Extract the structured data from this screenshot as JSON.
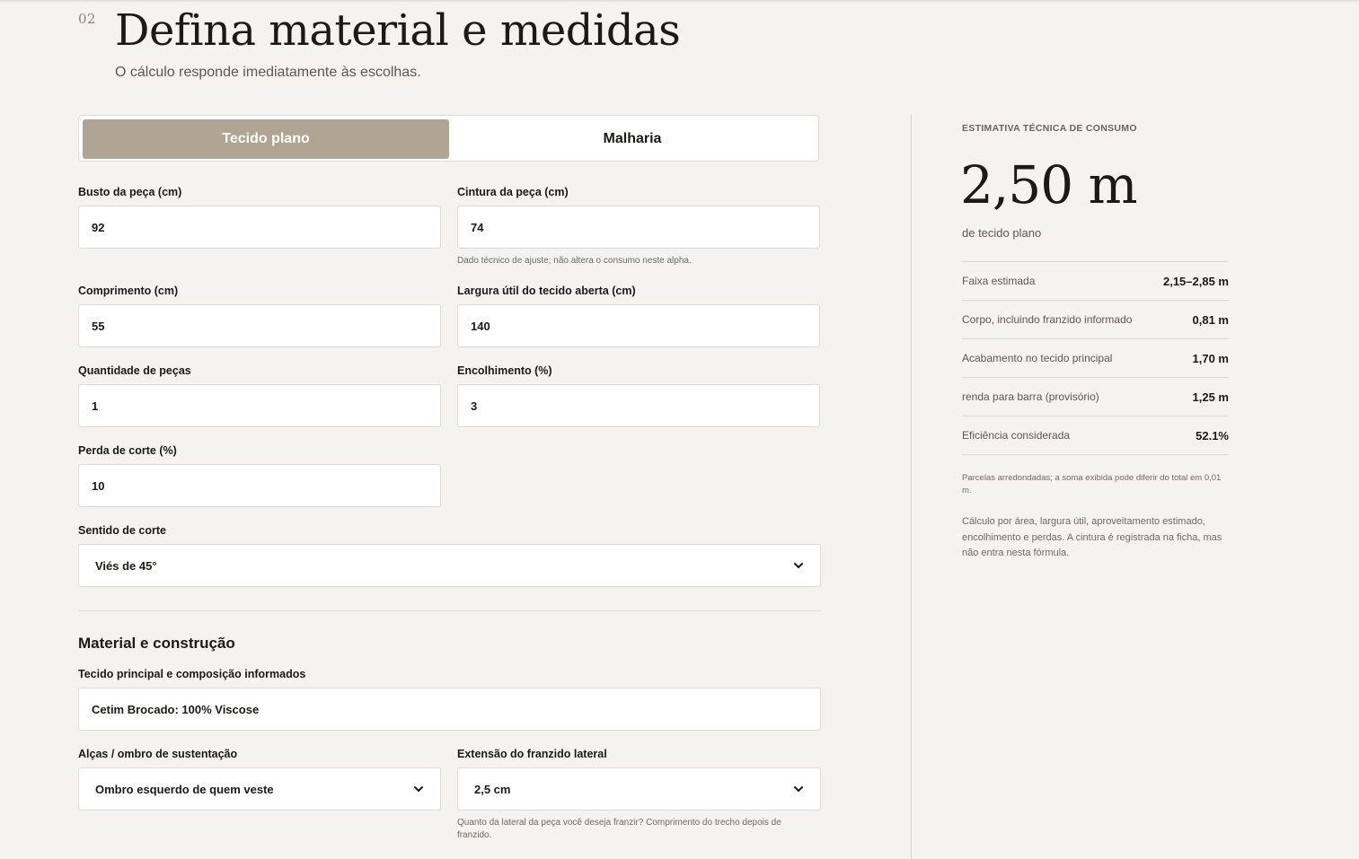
{
  "header": {
    "step": "02",
    "title": "Defina material e medidas",
    "subtitle": "O cálculo responde imediatamente às escolhas."
  },
  "fabric_type": {
    "options": [
      "Tecido plano",
      "Malharia"
    ],
    "selected": "Tecido plano"
  },
  "fields": {
    "busto": {
      "label": "Busto da peça (cm)",
      "value": "92"
    },
    "cintura": {
      "label": "Cintura da peça (cm)",
      "value": "74",
      "hint": "Dado técnico de ajuste; não altera o consumo neste alpha."
    },
    "comprimento": {
      "label": "Comprimento (cm)",
      "value": "55"
    },
    "largura": {
      "label": "Largura útil do tecido aberta (cm)",
      "value": "140"
    },
    "quantidade": {
      "label": "Quantidade de peças",
      "value": "1"
    },
    "encolhimento": {
      "label": "Encolhimento (%)",
      "value": "3"
    },
    "perda": {
      "label": "Perda de corte (%)",
      "value": "10"
    },
    "sentido": {
      "label": "Sentido de corte",
      "value": "Viés de 45°"
    }
  },
  "material": {
    "section_title": "Material e construção",
    "tecido": {
      "label": "Tecido principal e composição informados",
      "value": "Cetim Brocado: 100% Viscose"
    },
    "alcas": {
      "label": "Alças / ombro de sustentação",
      "value": "Ombro esquerdo de quem veste"
    },
    "franzido": {
      "label": "Extensão do franzido lateral",
      "value": "2,5 cm",
      "hint": "Quanto da lateral da peça você deseja franzir? Comprimento do trecho depois de franzido."
    }
  },
  "estimate": {
    "eyebrow": "ESTIMATIVA TÉCNICA DE CONSUMO",
    "value": "2,50 m",
    "unit": "de tecido plano",
    "rows": [
      {
        "label": "Faixa estimada",
        "value": "2,15–2,85 m"
      },
      {
        "label": "Corpo, incluindo franzido informado",
        "value": "0,81 m"
      },
      {
        "label": "Acabamento no tecido principal",
        "value": "1,70 m"
      },
      {
        "label": "renda para barra (provisório)",
        "value": "1,25 m"
      },
      {
        "label": "Eficiência considerada",
        "value": "52.1%"
      }
    ],
    "note_rounding": "Parcelas arredondadas; a soma exibida pode diferir do total em 0,01 m.",
    "note_method": "Cálculo por área, largura útil, aproveitamento estimado, encolhimento e perdas. A cintura é registrada na ficha, mas não entra nesta fórmula."
  },
  "colors": {
    "accent": "#b0a492",
    "background": "#f4f3f0",
    "border": "#dedbd5"
  }
}
